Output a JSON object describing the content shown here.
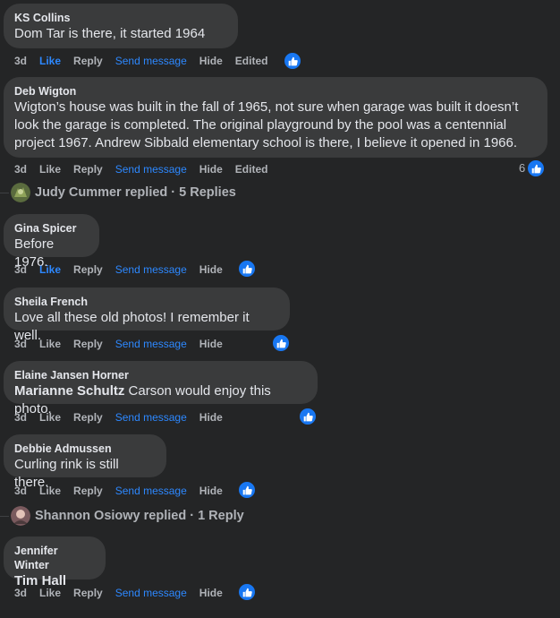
{
  "comments": [
    {
      "author": "KS Collins",
      "text": "Dom Tar is there, it started 1964",
      "actions": {
        "time": "3d",
        "like": "Like",
        "reply": "Reply",
        "send": "Send message",
        "hide": "Hide",
        "edited": "Edited"
      },
      "like_liked": true
    },
    {
      "author": "Deb Wigton",
      "text_lines": [
        "Wigton’s house was built in the fall of 1965, not sure when garage was built it doesn’t",
        "look the garage is completed. The original playground by the pool was a centennial",
        "project 1967. Andrew Sibbald elementary school is there, I believe it opened in 1966."
      ],
      "actions": {
        "time": "3d",
        "like": "Like",
        "reply": "Reply",
        "send": "Send message",
        "hide": "Hide",
        "edited": "Edited"
      },
      "like_count": "6"
    },
    {
      "author": "Gina Spicer",
      "text": "Before 1976.",
      "actions": {
        "time": "3d",
        "like": "Like",
        "reply": "Reply",
        "send": "Send message",
        "hide": "Hide"
      },
      "like_liked": true
    },
    {
      "author": "Sheila French",
      "text": "Love all these old photos! I remember it well.",
      "actions": {
        "time": "3d",
        "like": "Like",
        "reply": "Reply",
        "send": "Send message",
        "hide": "Hide"
      }
    },
    {
      "author": "Elaine Jansen Horner",
      "mention": "Marianne Schultz",
      "text": " Carson would enjoy this photo.",
      "actions": {
        "time": "3d",
        "like": "Like",
        "reply": "Reply",
        "send": "Send message",
        "hide": "Hide"
      }
    },
    {
      "author": "Debbie Admussen",
      "text": "Curling rink is still there.",
      "actions": {
        "time": "3d",
        "like": "Like",
        "reply": "Reply",
        "send": "Send message",
        "hide": "Hide"
      }
    },
    {
      "author": "Jennifer Winter",
      "mention": "Tim Hall",
      "actions": {
        "time": "3d",
        "like": "Like",
        "reply": "Reply",
        "send": "Send message",
        "hide": "Hide"
      }
    }
  ],
  "replies_threads": [
    {
      "text": "Judy Cummer replied · 5 Replies"
    },
    {
      "text": "Shannon Osiowy replied · 1 Reply"
    }
  ],
  "colors": {
    "background": "#242526",
    "bubble": "#3a3b3c",
    "accent": "#2d88ff",
    "like_badge": "#1877f2"
  },
  "icons": {
    "like_badge": "thumbs-up-icon"
  }
}
